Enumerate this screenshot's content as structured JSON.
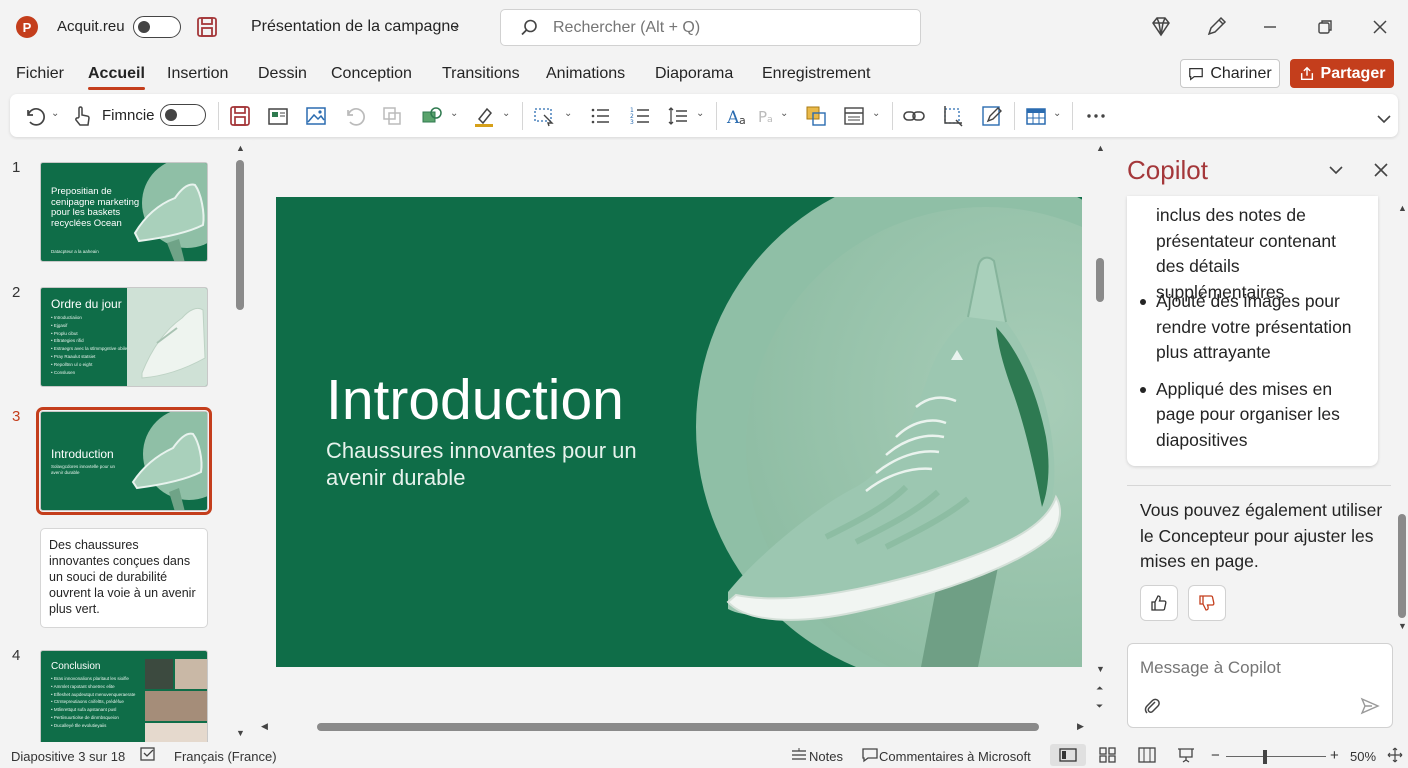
{
  "titlebar": {
    "app_logo": "P",
    "autosave_label": "Acquit.reu",
    "doc_title": "Présentation de la campagne",
    "search_placeholder": "Rechercher (Alt + Q)"
  },
  "menu": {
    "tabs": [
      "Fichier",
      "Accueil",
      "Insertion",
      "Dessin",
      "Conception",
      "Transitions",
      "Animations",
      "Diaporama",
      "Enregistrement"
    ],
    "active_tab": "Accueil",
    "comments_label": "Chariner",
    "share_label": "Partager"
  },
  "ribbon": {
    "toggle_label": "Fimncie"
  },
  "slides": {
    "thumbs": [
      {
        "number": "1",
        "title": "Prepositian de cenipagne marketing pour les baskets recyclées Ocean",
        "footer": "Datacpteur a la aaheain"
      },
      {
        "number": "2",
        "title": "Ordre du jour",
        "bullets": [
          "Introductiaiion",
          "Ejgasif",
          "Proplu cibut",
          "Eltrategies rifid",
          "Estraegrs avec la stlmmpgntive obile",
          "Pray Raaulut statsiet",
          "Repolltnn ul o eight",
          "Conslusen"
        ]
      },
      {
        "number": "3",
        "title": "Introduction",
        "subtitle": "Solavgcdores innovtelle pour un avenir durable"
      },
      {
        "number": "4",
        "title": "Conclusion",
        "bullets": [
          "Bras innovonalions plaritaut les sioifle",
          "Ammlet rapotant shoetrec elite",
          "Elfeshet aupdeutqut menuvenqueraerate",
          "Ctrntepreutiaons cnifeltts, prédéfue",
          "Mtlinrettqut sufa apstanant pusl",
          "Pertiisuurtiolse de dinmbsqueion",
          "Ducalleyé tlle evolutieyaiis"
        ]
      }
    ],
    "notes_text": "Des chaussures innovantes conçues dans un souci de durabilité ouvrent la voie à un avenir plus vert.",
    "active_index": 3
  },
  "slide": {
    "title": "Introduction",
    "subtitle": "Chaussures innovantes pour un avenir durable"
  },
  "copilot": {
    "title": "Copilot",
    "continued_text": "inclus des notes de présentateur contenant des détails supplémentaires",
    "bullets": [
      "Ajouté des images pour rendre votre présentation plus attrayante",
      "Appliqué des mises en page pour organiser les diapositives"
    ],
    "followup": "Vous pouvez également utiliser le Concepteur pour ajuster les mises en page.",
    "input_placeholder": "Message à Copilot"
  },
  "status": {
    "slide_counter": "Diapositive 3 sur 18",
    "language": "Français (France)",
    "notes_label": "Notes",
    "comments_label": "Commentaires à Microsoft",
    "zoom_minus": "−",
    "zoom_plus": "+",
    "zoom": "50%"
  },
  "colors": {
    "accent": "#c43e1c",
    "copilot_title": "#a4373a",
    "slide_green": "#0f6d48",
    "slide_mint": "#8fbfa6"
  }
}
